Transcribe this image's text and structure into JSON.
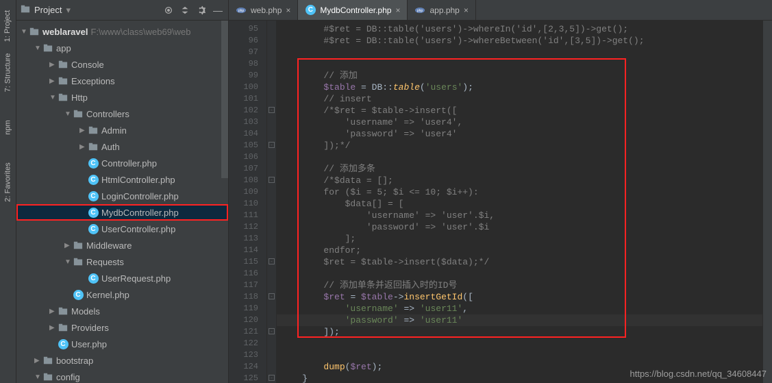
{
  "leftRail": [
    {
      "label": "1: Project"
    },
    {
      "label": "7: Structure"
    },
    {
      "label": "npm"
    },
    {
      "label": "2: Favorites"
    }
  ],
  "sidebar": {
    "headerTitle": "Project",
    "root": {
      "name": "weblaravel",
      "path": "F:\\www\\class\\web69\\web"
    },
    "tree": [
      {
        "indent": 0,
        "arrow": "▼",
        "type": "folder",
        "label": "app"
      },
      {
        "indent": 1,
        "arrow": "▶",
        "type": "folder",
        "label": "Console"
      },
      {
        "indent": 1,
        "arrow": "▶",
        "type": "folder",
        "label": "Exceptions"
      },
      {
        "indent": 1,
        "arrow": "▼",
        "type": "folder",
        "label": "Http"
      },
      {
        "indent": 2,
        "arrow": "▼",
        "type": "folder",
        "label": "Controllers"
      },
      {
        "indent": 3,
        "arrow": "▶",
        "type": "folder",
        "label": "Admin"
      },
      {
        "indent": 3,
        "arrow": "▶",
        "type": "folder",
        "label": "Auth"
      },
      {
        "indent": 3,
        "arrow": "",
        "type": "cfile",
        "label": "Controller.php"
      },
      {
        "indent": 3,
        "arrow": "",
        "type": "cfile",
        "label": "HtmlController.php"
      },
      {
        "indent": 3,
        "arrow": "",
        "type": "cfile",
        "label": "LoginController.php"
      },
      {
        "indent": 3,
        "arrow": "",
        "type": "cfile",
        "label": "MydbController.php",
        "selected": true,
        "redbox": true
      },
      {
        "indent": 3,
        "arrow": "",
        "type": "cfile",
        "label": "UserController.php"
      },
      {
        "indent": 2,
        "arrow": "▶",
        "type": "folder",
        "label": "Middleware"
      },
      {
        "indent": 2,
        "arrow": "▼",
        "type": "folder",
        "label": "Requests"
      },
      {
        "indent": 3,
        "arrow": "",
        "type": "cfile",
        "label": "UserRequest.php"
      },
      {
        "indent": 2,
        "arrow": "",
        "type": "cfile",
        "label": "Kernel.php"
      },
      {
        "indent": 1,
        "arrow": "▶",
        "type": "folder",
        "label": "Models"
      },
      {
        "indent": 1,
        "arrow": "▶",
        "type": "folder",
        "label": "Providers"
      },
      {
        "indent": 1,
        "arrow": "",
        "type": "cfile",
        "label": "User.php"
      },
      {
        "indent": 0,
        "arrow": "▶",
        "type": "folder",
        "label": "bootstrap"
      },
      {
        "indent": 0,
        "arrow": "▼",
        "type": "folder",
        "label": "config"
      }
    ]
  },
  "tabs": [
    {
      "label": "web.php",
      "active": false,
      "icon": "php"
    },
    {
      "label": "MydbController.php",
      "active": true,
      "icon": "c"
    },
    {
      "label": "app.php",
      "active": false,
      "icon": "php"
    }
  ],
  "editor": {
    "startLine": 95,
    "endLine": 125,
    "currentLine": 120,
    "lines": [
      {
        "n": 95,
        "html": "        <span class='c-comment'>#$ret = DB::table('users')-&gt;whereIn('id',[2,3,5])-&gt;get();</span>"
      },
      {
        "n": 96,
        "html": "        <span class='c-comment'>#$ret = DB::table('users')-&gt;whereBetween('id',[3,5])-&gt;get();</span>"
      },
      {
        "n": 97,
        "html": ""
      },
      {
        "n": 98,
        "html": ""
      },
      {
        "n": 99,
        "html": "        <span class='c-comment'>// 添加</span>"
      },
      {
        "n": 100,
        "html": "        <span class='c-var'>$table</span> = <span class='c-class'>DB</span>::<span class='c-static'>table</span>(<span class='c-string'>'users'</span>);"
      },
      {
        "n": 101,
        "html": "        <span class='c-comment'>// insert</span>"
      },
      {
        "n": 102,
        "html": "        <span class='c-comment'>/*$ret = $table-&gt;insert([</span>"
      },
      {
        "n": 103,
        "html": "<span class='c-comment'>            'username' =&gt; 'user4',</span>"
      },
      {
        "n": 104,
        "html": "<span class='c-comment'>            'password' =&gt; 'user4'</span>"
      },
      {
        "n": 105,
        "html": "<span class='c-comment'>        ]);*/</span>"
      },
      {
        "n": 106,
        "html": ""
      },
      {
        "n": 107,
        "html": "        <span class='c-comment'>// 添加多条</span>"
      },
      {
        "n": 108,
        "html": "        <span class='c-comment'>/*$data = [];</span>"
      },
      {
        "n": 109,
        "html": "<span class='c-comment'>        for ($i = 5; $i &lt;= 10; $i++):</span>"
      },
      {
        "n": 110,
        "html": "<span class='c-comment'>            $data[] = [</span>"
      },
      {
        "n": 111,
        "html": "<span class='c-comment'>                'username' =&gt; 'user'.$i,</span>"
      },
      {
        "n": 112,
        "html": "<span class='c-comment'>                'password' =&gt; 'user'.$i</span>"
      },
      {
        "n": 113,
        "html": "<span class='c-comment'>            ];</span>"
      },
      {
        "n": 114,
        "html": "<span class='c-comment'>        endfor;</span>"
      },
      {
        "n": 115,
        "html": "<span class='c-comment'>        $ret = $table-&gt;insert($data);*/</span>"
      },
      {
        "n": 116,
        "html": ""
      },
      {
        "n": 117,
        "html": "        <span class='c-comment'>// 添加单条并返回插入时的ID号</span>"
      },
      {
        "n": 118,
        "html": "        <span class='c-var'>$ret</span> = <span class='c-var'>$table</span>-&gt;<span class='c-func'>insertGetId</span>(["
      },
      {
        "n": 119,
        "html": "            <span class='c-string'>'username'</span> =&gt; <span class='c-string'>'user11'</span>,"
      },
      {
        "n": 120,
        "html": "            <span class='c-string'>'password'</span> =&gt; <span class='c-string'>'user11'</span>"
      },
      {
        "n": 121,
        "html": "        ]);"
      },
      {
        "n": 122,
        "html": ""
      },
      {
        "n": 123,
        "html": ""
      },
      {
        "n": 124,
        "html": "        <span class='c-func'>dump</span>(<span class='c-var'>$ret</span>);"
      },
      {
        "n": 125,
        "html": "    }"
      }
    ]
  },
  "watermark": "https://blog.csdn.net/qq_34608447"
}
